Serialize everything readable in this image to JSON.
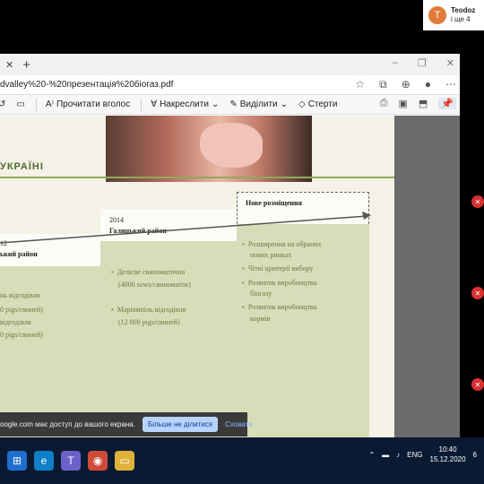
{
  "participant": {
    "avatar_letter": "T",
    "name": "Teodoz",
    "more": "і ще 4"
  },
  "tab": {
    "close": "✕",
    "new": "+"
  },
  "window": {
    "min": "–",
    "restore": "❐",
    "close": "✕"
  },
  "address": {
    "url": "dvalley%20-%20презентація%20біогаз.pdf"
  },
  "pdf_toolbar": {
    "read_aloud": "Прочитати вголос",
    "draw": "Накреслити",
    "highlight": "Виділити",
    "erase": "Стерти"
  },
  "slide": {
    "title": "УКРАЇНІ",
    "columns": [
      {
        "year": "12",
        "region": "ький район",
        "items": [
          "нь відгодівля",
          "0  pigs/свиней)",
          "відгодівля",
          "0 pigs/свиней)"
        ]
      },
      {
        "year": "2014",
        "region": "Галицький район",
        "items": [
          "Делісве свиноматочна",
          "(4000 sows/свиноматок)",
          "Маріямпіль відгодівля",
          "(12 000 pigs/свиней)"
        ]
      },
      {
        "year": "",
        "region": "Нове розміщення",
        "items": [
          "Розширення на обраних",
          "нових ринках",
          "Чіткі критерії вибору",
          "Розвиток виробництва",
          "біогазу",
          "Розвиток виробництва",
          "кормів"
        ]
      }
    ]
  },
  "share": {
    "message": "oogle.com має доступ до вашого екрана.",
    "stop": "Більше не ділитися",
    "hide": "Сховати"
  },
  "taskbar": {
    "lang": "ENG",
    "time": "10:40",
    "date": "15.12.2020",
    "notif": "6"
  },
  "colors": {
    "accent": "#4e6b2e",
    "column_fill": "#d7ddb8",
    "taskbar": "#0b1a33"
  }
}
